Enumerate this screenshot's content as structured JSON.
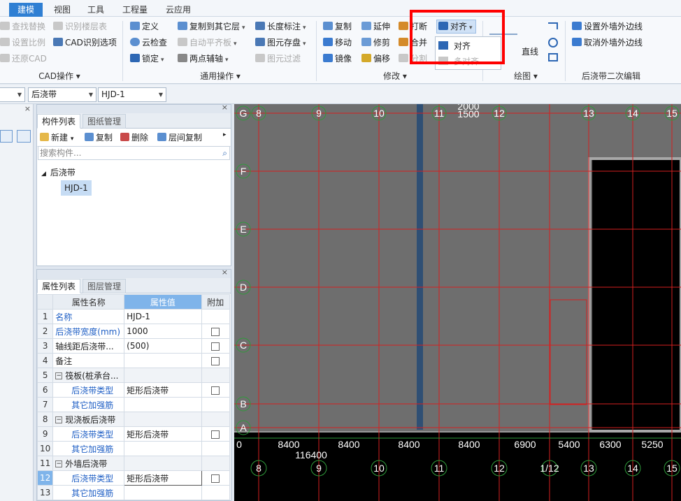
{
  "menubar": {
    "tabs": [
      {
        "label": "建模",
        "active": true
      },
      {
        "label": "视图",
        "active": false
      },
      {
        "label": "工具",
        "active": false
      },
      {
        "label": "工程量",
        "active": false
      },
      {
        "label": "云应用",
        "active": false
      }
    ]
  },
  "ribbon": {
    "cad": {
      "group_label": "CAD操作 ▾",
      "items": [
        "查找替换",
        "识别楼层表",
        "设置比例",
        "CAD识别选项",
        "还原CAD"
      ]
    },
    "common": {
      "group_label": "通用操作 ▾",
      "items": [
        "定义",
        "复制到其它层",
        "长度标注",
        "云检查",
        "自动平齐板",
        "图元存盘",
        "锁定",
        "两点辅轴",
        "图元过滤"
      ]
    },
    "modify": {
      "group_label": "修改 ▾",
      "items": [
        "复制",
        "延伸",
        "打断",
        "对齐",
        "移动",
        "修剪",
        "合并",
        "镜像",
        "偏移",
        "分割"
      ]
    },
    "draw": {
      "group_label": "绘图 ▾",
      "items": [
        "直线"
      ]
    },
    "edit2": {
      "group_label": "后浇带二次编辑",
      "items": [
        "设置外墙外边线",
        "取消外墙外边线"
      ]
    },
    "align_dropdown": {
      "items": [
        "对齐",
        "多对齐"
      ]
    }
  },
  "combobar": {
    "combo1": "",
    "combo2": "后浇带",
    "combo3": "HJD-1"
  },
  "component_panel": {
    "tabs": [
      "构件列表",
      "图纸管理"
    ],
    "toolbar": [
      "新建",
      "复制",
      "删除",
      "层间复制"
    ],
    "search_placeholder": "搜索构件...",
    "tree": {
      "root": "后浇带",
      "child": "HJD-1"
    }
  },
  "property_panel": {
    "tabs": [
      "属性列表",
      "图层管理"
    ],
    "headers": [
      "属性名称",
      "属性值",
      "附加"
    ],
    "rows": [
      {
        "num": "1",
        "name": "名称",
        "value": "HJD-1",
        "indent": 0,
        "blue": true,
        "check": false
      },
      {
        "num": "2",
        "name": "后浇带宽度(mm)",
        "value": "1000",
        "indent": 0,
        "blue": true,
        "check": true
      },
      {
        "num": "3",
        "name": "轴线距后浇带...",
        "value": "(500)",
        "indent": 0,
        "blue": false,
        "check": true
      },
      {
        "num": "4",
        "name": "备注",
        "value": "",
        "indent": 0,
        "blue": false,
        "check": true
      },
      {
        "num": "5",
        "name": "筏板(桩承台...",
        "value": "",
        "indent": 0,
        "blue": false,
        "check": false,
        "group": true
      },
      {
        "num": "6",
        "name": "后浇带类型",
        "value": "矩形后浇带",
        "indent": 1,
        "blue": true,
        "check": true
      },
      {
        "num": "7",
        "name": "其它加强筋",
        "value": "",
        "indent": 1,
        "blue": true,
        "check": false
      },
      {
        "num": "8",
        "name": "现浇板后浇带",
        "value": "",
        "indent": 0,
        "blue": false,
        "check": false,
        "group": true
      },
      {
        "num": "9",
        "name": "后浇带类型",
        "value": "矩形后浇带",
        "indent": 1,
        "blue": true,
        "check": true
      },
      {
        "num": "10",
        "name": "其它加强筋",
        "value": "",
        "indent": 1,
        "blue": true,
        "check": false
      },
      {
        "num": "11",
        "name": "外墙后浇带",
        "value": "",
        "indent": 0,
        "blue": false,
        "check": false,
        "group": true
      },
      {
        "num": "12",
        "name": "后浇带类型",
        "value": "矩形后浇带",
        "indent": 1,
        "blue": true,
        "check": true,
        "active": true
      },
      {
        "num": "13",
        "name": "其它加强筋",
        "value": "",
        "indent": 1,
        "blue": true,
        "check": false
      }
    ]
  },
  "canvas": {
    "row_axes": [
      "G",
      "F",
      "E",
      "D",
      "C",
      "B",
      "A"
    ],
    "top_axes": [
      "8",
      "9",
      "10",
      "11",
      "12",
      "13",
      "14",
      "15"
    ],
    "bottom_axes": [
      "8",
      "9",
      "10",
      "11",
      "12",
      "1/12",
      "13",
      "14",
      "15"
    ],
    "dims_bottom": [
      "0",
      "8400",
      "8400",
      "8400",
      "8400",
      "6900",
      "5400",
      "6300",
      "5250"
    ],
    "total_dim": "116400",
    "top_dims": [
      "2000",
      "1500"
    ],
    "colors": {
      "slab": "#6e6e6e",
      "grid": "#d42020",
      "axis": "#2e9b3a",
      "band": "#2f4f74"
    }
  }
}
